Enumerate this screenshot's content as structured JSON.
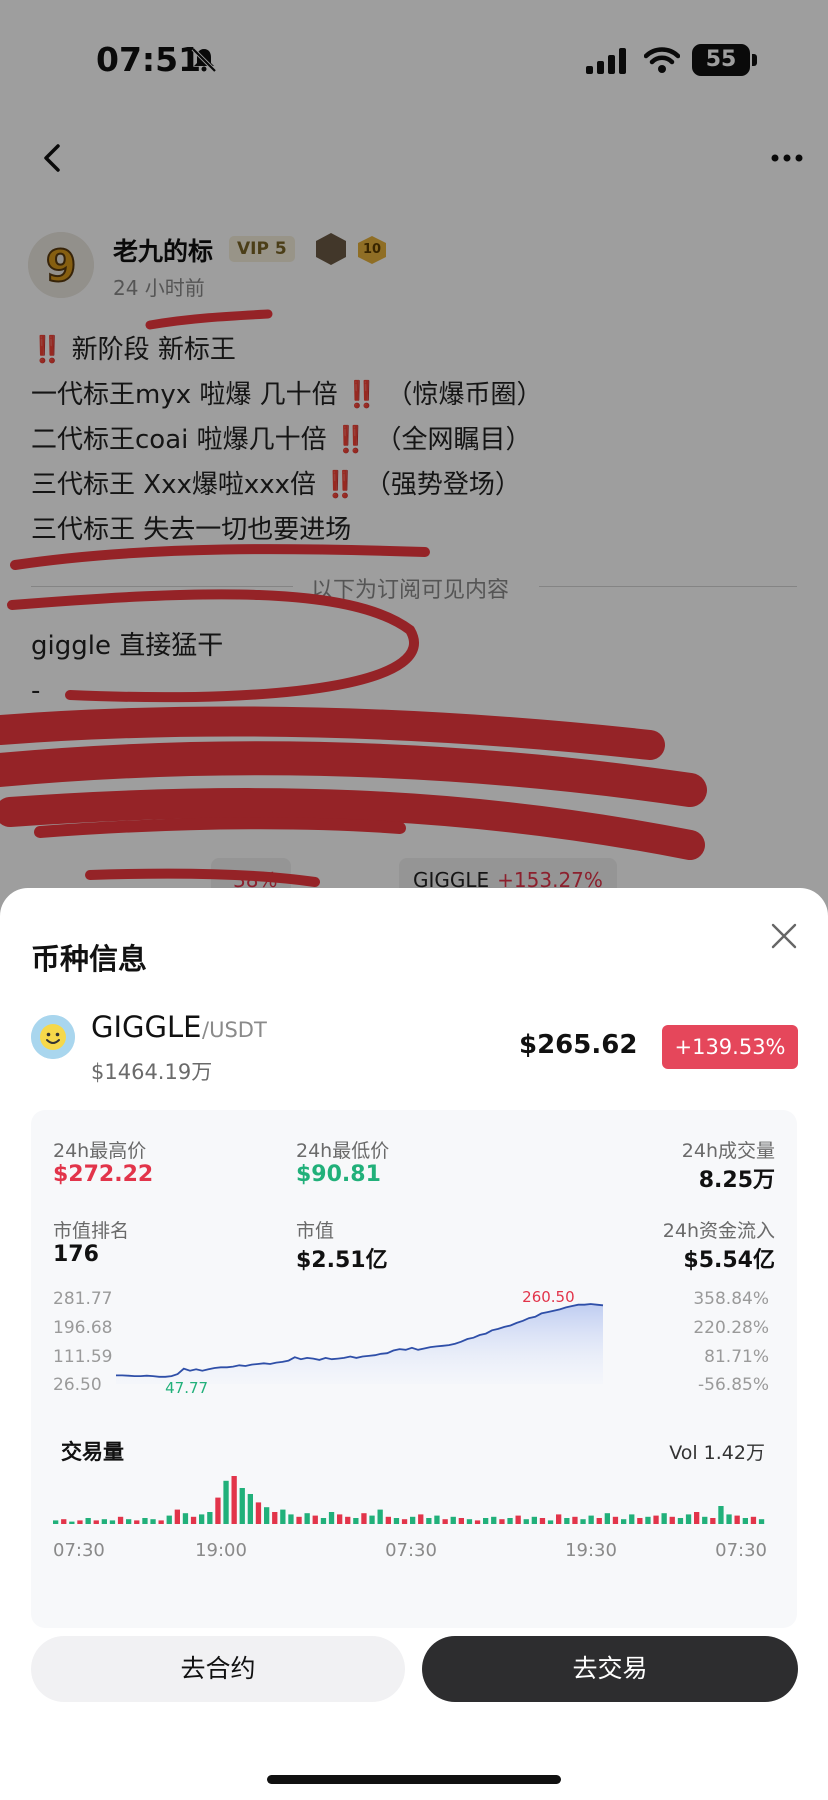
{
  "status_bar": {
    "time": "07:51",
    "battery": "55"
  },
  "author": {
    "name": "老九的标",
    "vip": "VIP 5",
    "level": "10",
    "posted": "24 小时前"
  },
  "post": {
    "lines": [
      {
        "prefix": "‼️",
        "text": " 新阶段 新标王",
        "suffix": ""
      },
      {
        "prefix": "",
        "text": "一代标王myx 啦爆 几十倍 ",
        "suffix": "‼️ （惊爆币圈）"
      },
      {
        "prefix": "",
        "text": "二代标王coai 啦爆几十倍 ",
        "suffix": "‼️ （全网瞩目）"
      },
      {
        "prefix": "",
        "text": "三代标王 Xxx爆啦xxx倍 ",
        "suffix": "‼️ （强势登场）"
      },
      {
        "prefix": "",
        "text": "三代标王 失去一切也要进场",
        "suffix": ""
      }
    ],
    "subscriber_divider": "以下为订阅可见内容",
    "hidden_lines": [
      "giggle  直接猛干",
      "-"
    ],
    "chips": [
      {
        "symbol": "GIGGLE",
        "change": "+153.27%"
      },
      {
        "symbol": "",
        "change": "38%"
      }
    ]
  },
  "sheet": {
    "title": "币种信息",
    "coin": {
      "symbol": "GIGGLE",
      "pair": "/USDT",
      "market_cap": "$1464.19万",
      "price": "$265.62",
      "change": "+139.53%"
    },
    "stats": {
      "high_label": "24h最高价",
      "high": "$272.22",
      "low_label": "24h最低价",
      "low": "$90.81",
      "volume_label": "24h成交量",
      "volume": "8.25万",
      "rank_label": "市值排名",
      "rank": "176",
      "cap_label": "市值",
      "cap": "$2.51亿",
      "inflow_label": "24h资金流入",
      "inflow": "$5.54亿"
    },
    "volume_title": "交易量",
    "volume_total": "Vol 1.42万",
    "buttons": {
      "futures": "去合约",
      "trade": "去交易"
    }
  },
  "colors": {
    "up": "#e2344a",
    "down": "#21b07a",
    "line": "#2f4fa8",
    "accent_badge": "#e5475b"
  },
  "chart_data": [
    {
      "type": "line",
      "title": "",
      "y_ticks_left": [
        "281.77",
        "196.68",
        "111.59",
        "26.50"
      ],
      "y_ticks_right": [
        "358.84%",
        "220.28%",
        "81.71%",
        "-56.85%"
      ],
      "ylim": [
        26.5,
        281.77
      ],
      "annotations": {
        "low": "47.77",
        "high": "260.50"
      },
      "x": [
        0,
        1,
        2,
        3,
        4,
        5,
        6,
        7,
        8,
        9,
        10,
        11,
        12,
        13,
        14,
        15,
        16,
        17,
        18,
        19,
        20,
        21,
        22,
        23,
        24,
        25,
        26,
        27,
        28,
        29,
        30,
        31,
        32,
        33,
        34,
        35,
        36,
        37,
        38,
        39,
        40,
        41,
        42,
        43,
        44,
        45,
        46,
        47,
        48,
        49,
        50,
        51,
        52,
        53,
        54,
        55,
        56,
        57,
        58,
        59,
        60,
        61,
        62,
        63,
        64,
        65,
        66,
        67,
        68,
        69,
        70,
        71,
        72,
        73,
        74,
        75,
        76,
        77,
        78,
        79
      ],
      "values": [
        52,
        52,
        51,
        50,
        50,
        51,
        50,
        48,
        48,
        50,
        56,
        72,
        66,
        70,
        66,
        70,
        74,
        76,
        76,
        78,
        82,
        80,
        84,
        86,
        88,
        86,
        90,
        92,
        96,
        106,
        100,
        104,
        102,
        98,
        104,
        100,
        102,
        104,
        108,
        104,
        108,
        110,
        112,
        116,
        118,
        126,
        130,
        128,
        134,
        128,
        132,
        136,
        138,
        140,
        142,
        146,
        152,
        160,
        164,
        172,
        176,
        186,
        190,
        196,
        200,
        208,
        214,
        222,
        226,
        236,
        240,
        244,
        248,
        254,
        258,
        262,
        262,
        264,
        262,
        260
      ]
    },
    {
      "type": "bar",
      "title": "交易量",
      "x_tick_labels": [
        "07:30",
        "19:00",
        "07:30",
        "19:30",
        "07:30"
      ],
      "values": [
        3,
        4,
        2,
        3,
        5,
        3,
        4,
        3,
        6,
        4,
        3,
        5,
        4,
        3,
        7,
        12,
        9,
        6,
        8,
        10,
        22,
        36,
        40,
        30,
        25,
        18,
        14,
        10,
        12,
        8,
        6,
        9,
        7,
        5,
        10,
        8,
        6,
        5,
        9,
        7,
        12,
        6,
        5,
        4,
        6,
        8,
        5,
        7,
        4,
        6,
        5,
        4,
        3,
        5,
        6,
        4,
        5,
        7,
        4,
        6,
        5,
        3,
        8,
        5,
        6,
        4,
        7,
        5,
        9,
        6,
        4,
        8,
        5,
        6,
        7,
        9,
        6,
        5,
        8,
        10,
        6,
        5,
        15,
        8,
        7,
        5,
        6,
        4
      ],
      "up": [
        1,
        0,
        1,
        0,
        1,
        0,
        1,
        1,
        0,
        1,
        0,
        1,
        1,
        0,
        1,
        0,
        1,
        0,
        1,
        1,
        0,
        1,
        0,
        1,
        1,
        0,
        1,
        0,
        1,
        1,
        0,
        1,
        0,
        1,
        1,
        0,
        0,
        1,
        0,
        1,
        1,
        0,
        1,
        0,
        1,
        0,
        1,
        1,
        0,
        1,
        0,
        1,
        0,
        1,
        1,
        0,
        1,
        0,
        1,
        1,
        0,
        1,
        0,
        1,
        0,
        1,
        1,
        0,
        1,
        0,
        1,
        1,
        0,
        1,
        0,
        1,
        0,
        1,
        1,
        0,
        1,
        0,
        1,
        1,
        0,
        1,
        0,
        1
      ]
    }
  ]
}
